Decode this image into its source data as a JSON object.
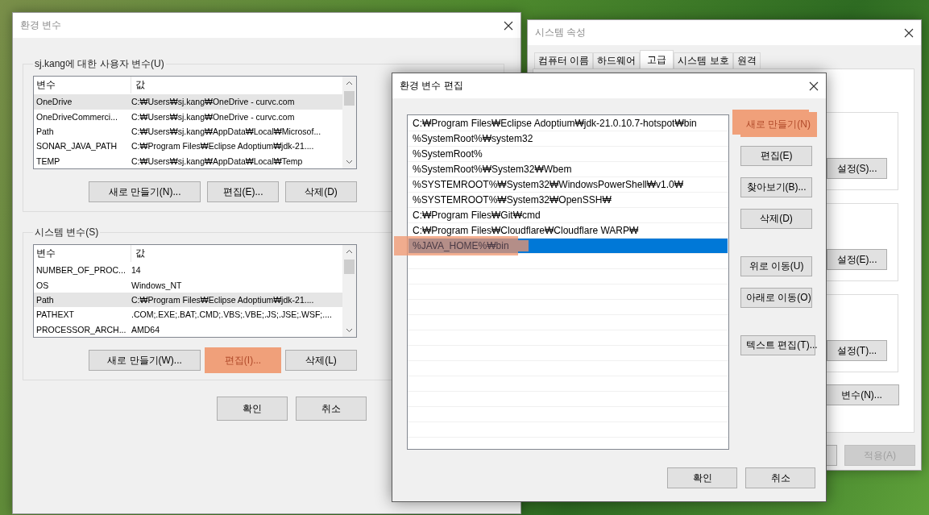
{
  "env_window": {
    "title": "환경 변수",
    "active": false,
    "user_group": {
      "label": "sj.kang에 대한 사용자 변수(U)",
      "columns": [
        "변수",
        "값"
      ],
      "rows": [
        {
          "name": "OneDrive",
          "value": "C:₩Users₩sj.kang₩OneDrive - curvc.com",
          "selected": true
        },
        {
          "name": "OneDriveCommerci...",
          "value": "C:₩Users₩sj.kang₩OneDrive - curvc.com",
          "selected": false
        },
        {
          "name": "Path",
          "value": "C:₩Users₩sj.kang₩AppData₩Local₩Microsof...",
          "selected": false
        },
        {
          "name": "SONAR_JAVA_PATH",
          "value": "C:₩Program Files₩Eclipse Adoptium₩jdk-21....",
          "selected": false
        },
        {
          "name": "TEMP",
          "value": "C:₩Users₩sj.kang₩AppData₩Local₩Temp",
          "selected": false
        }
      ],
      "buttons": [
        {
          "label": "새로 만들기(N)...",
          "highlighted": false
        },
        {
          "label": "편집(E)...",
          "highlighted": false
        },
        {
          "label": "삭제(D)",
          "highlighted": false
        }
      ]
    },
    "system_group": {
      "label": "시스템 변수(S)",
      "columns": [
        "변수",
        "값"
      ],
      "rows": [
        {
          "name": "NUMBER_OF_PROC...",
          "value": "14",
          "selected": false
        },
        {
          "name": "OS",
          "value": "Windows_NT",
          "selected": false
        },
        {
          "name": "Path",
          "value": "C:₩Program Files₩Eclipse Adoptium₩jdk-21....",
          "selected": true
        },
        {
          "name": "PATHEXT",
          "value": ".COM;.EXE;.BAT;.CMD;.VBS;.VBE;.JS;.JSE;.WSF;....",
          "selected": false
        },
        {
          "name": "PROCESSOR_ARCH...",
          "value": "AMD64",
          "selected": false
        }
      ],
      "buttons": [
        {
          "label": "새로 만들기(W)...",
          "highlighted": false
        },
        {
          "label": "편집(I)...",
          "highlighted": true
        },
        {
          "label": "삭제(L)",
          "highlighted": false
        }
      ]
    },
    "buttons": [
      {
        "label": "확인",
        "highlighted": false
      },
      {
        "label": "취소",
        "highlighted": false
      }
    ]
  },
  "system_properties": {
    "title": "시스템 속성",
    "active": false,
    "tabs": [
      {
        "label": "컴퓨터 이름",
        "selected": false
      },
      {
        "label": "하드웨어",
        "selected": false
      },
      {
        "label": "고급",
        "selected": true
      },
      {
        "label": "시스템 보호",
        "selected": false
      },
      {
        "label": "원격",
        "selected": false
      }
    ],
    "group_buttons": [
      "설정(S)...",
      "설정(E)...",
      "설정(T)..."
    ],
    "env_button": "변수(N)...",
    "apply_button": {
      "label": "적용(A)",
      "disabled": true
    }
  },
  "edit_window": {
    "title": "환경 변수 편집",
    "active": true,
    "entries": [
      {
        "text": "C:₩Program Files₩Eclipse Adoptium₩jdk-21.0.10.7-hotspot₩bin",
        "selected": false,
        "highlighted": false
      },
      {
        "text": "%SystemRoot%₩system32",
        "selected": false,
        "highlighted": false
      },
      {
        "text": "%SystemRoot%",
        "selected": false,
        "highlighted": false
      },
      {
        "text": "%SystemRoot%₩System32₩Wbem",
        "selected": false,
        "highlighted": false
      },
      {
        "text": "%SYSTEMROOT%₩System32₩WindowsPowerShell₩v1.0₩",
        "selected": false,
        "highlighted": false
      },
      {
        "text": "%SYSTEMROOT%₩System32₩OpenSSH₩",
        "selected": false,
        "highlighted": false
      },
      {
        "text": "C:₩Program Files₩Git₩cmd",
        "selected": false,
        "highlighted": false
      },
      {
        "text": "C:₩Program Files₩Cloudflare₩Cloudflare WARP₩",
        "selected": false,
        "highlighted": false
      },
      {
        "text": "%JAVA_HOME%₩bin",
        "selected": true,
        "highlighted": true
      }
    ],
    "side_button_groups": [
      [
        {
          "label": "새로 만들기(N)",
          "highlighted": true
        },
        {
          "label": "편집(E)",
          "highlighted": false
        },
        {
          "label": "찾아보기(B)...",
          "highlighted": false
        },
        {
          "label": "삭제(D)",
          "highlighted": false
        }
      ],
      [
        {
          "label": "위로 이동(U)",
          "highlighted": false
        },
        {
          "label": "아래로 이동(O)",
          "highlighted": false
        }
      ],
      [
        {
          "label": "텍스트 편집(T)...",
          "highlighted": false
        }
      ]
    ],
    "buttons": [
      {
        "label": "확인",
        "highlighted": false
      },
      {
        "label": "취소",
        "highlighted": false
      }
    ]
  }
}
